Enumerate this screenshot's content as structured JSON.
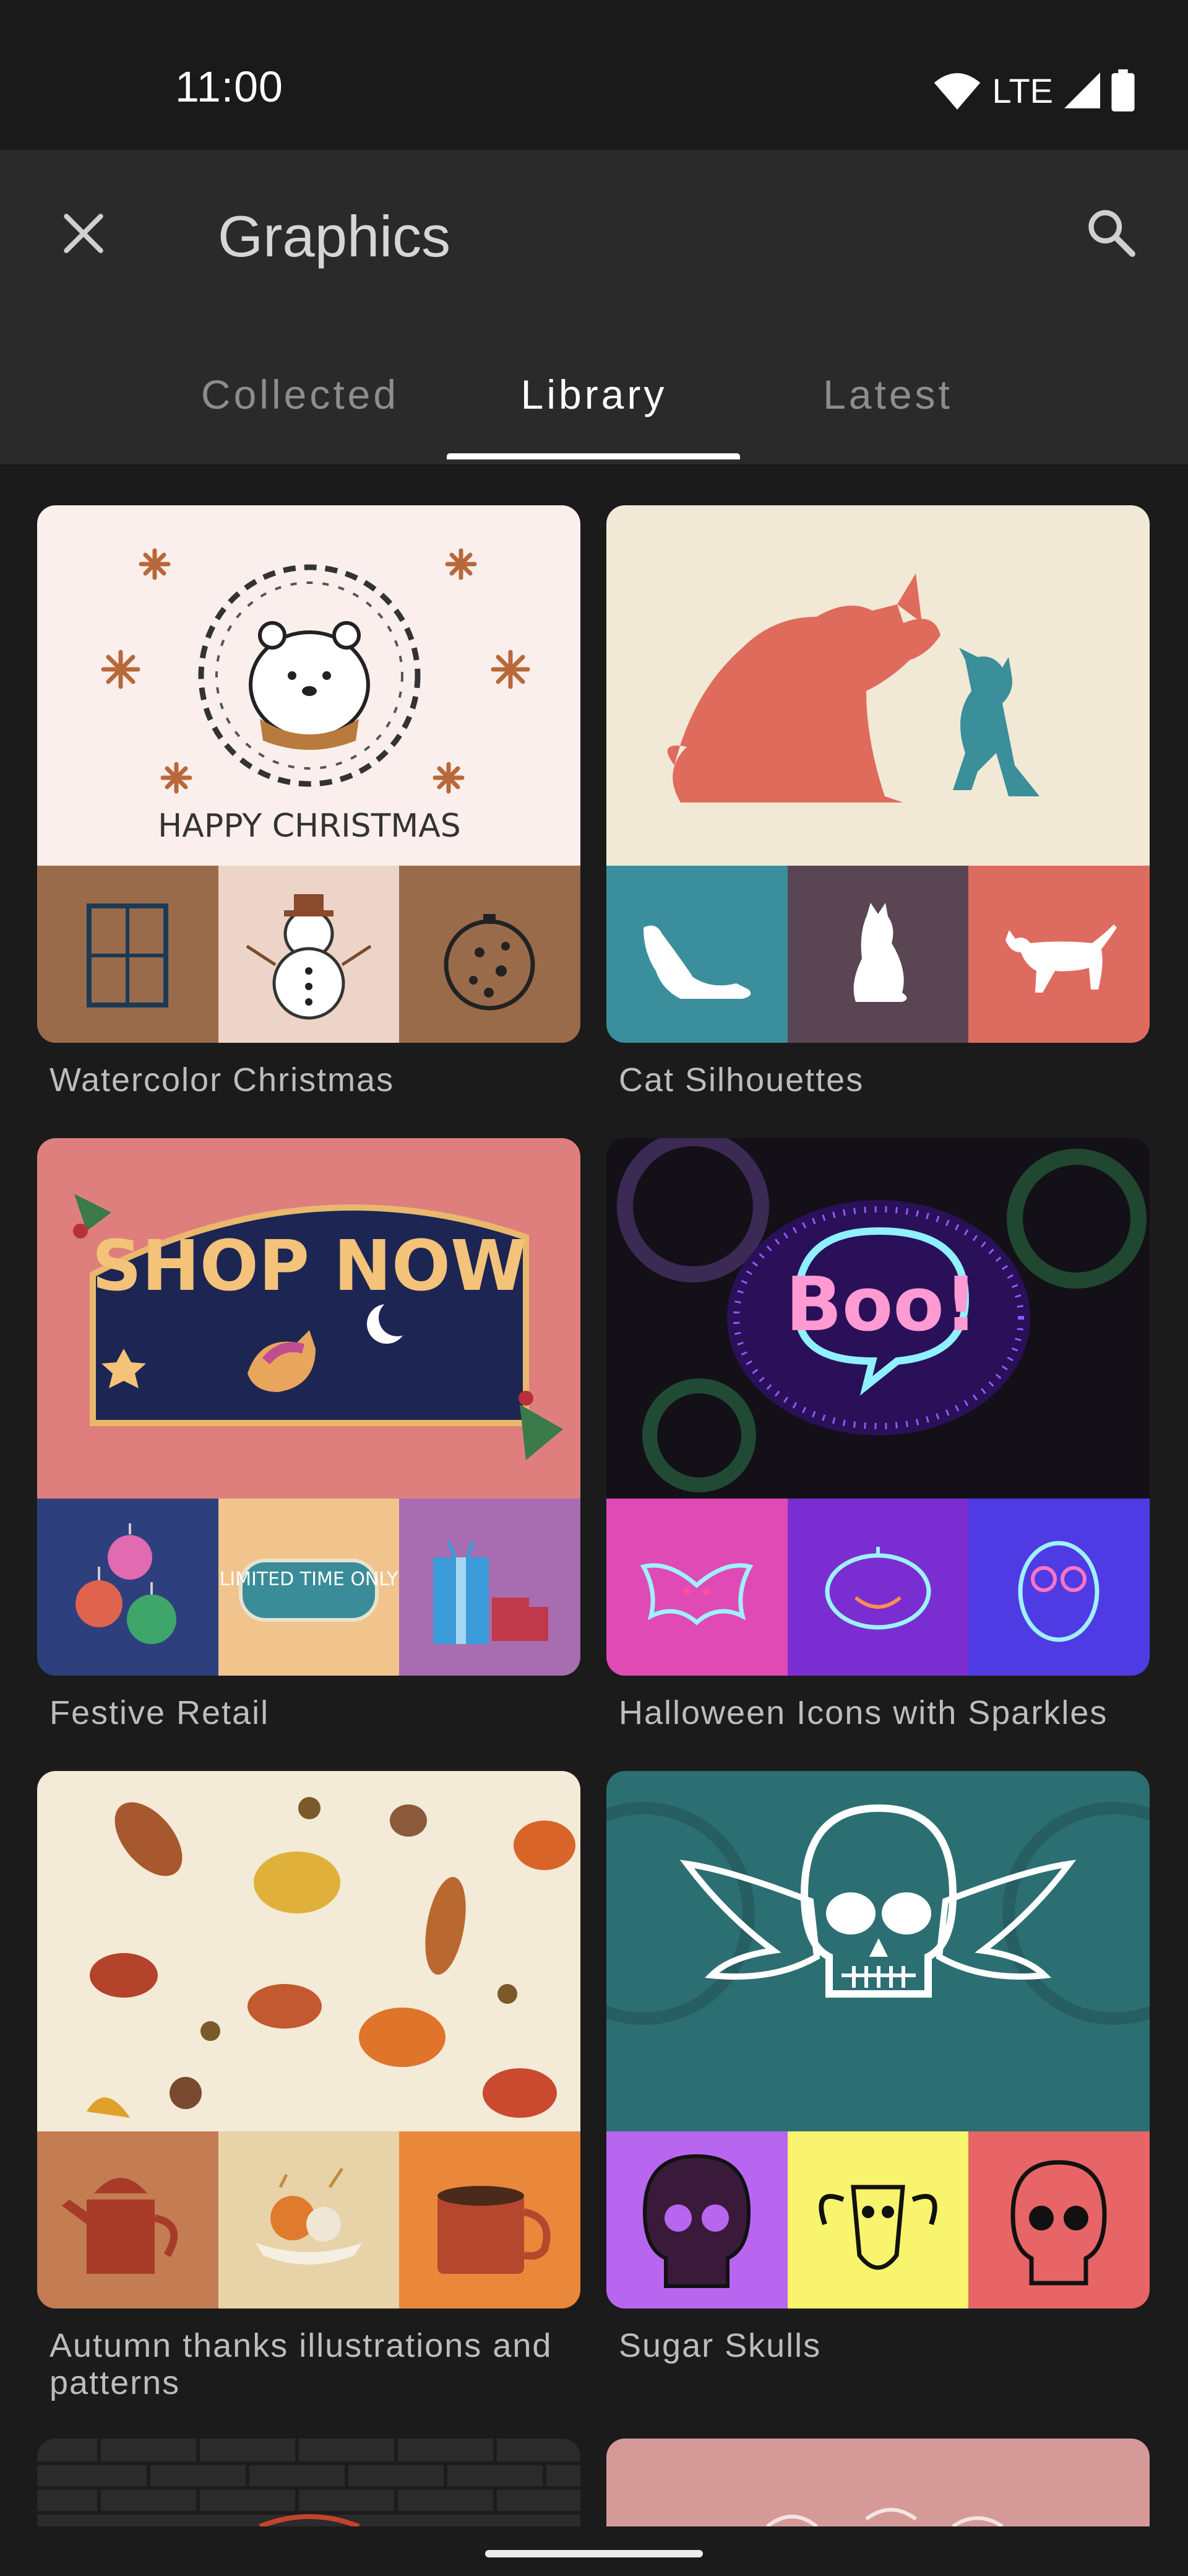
{
  "status_bar": {
    "time": "11:00",
    "network": "LTE",
    "icons": [
      "wifi-icon",
      "cell-signal-icon",
      "battery-icon"
    ]
  },
  "app_bar": {
    "title": "Graphics",
    "close_icon": "close-icon",
    "search_icon": "search-icon"
  },
  "tabs": [
    {
      "label": "Collected",
      "active": false
    },
    {
      "label": "Library",
      "active": true
    },
    {
      "label": "Latest",
      "active": false
    }
  ],
  "collections": [
    {
      "title": "Watercolor Christmas",
      "hero_text": "HAPPY CHRISTMAS"
    },
    {
      "title": "Cat Silhouettes"
    },
    {
      "title": "Festive Retail",
      "hero_text": "SHOP NOW",
      "thumb_text": "LIMITED TIME ONLY"
    },
    {
      "title": "Halloween Icons with Sparkles",
      "hero_text": "Boo!"
    },
    {
      "title": "Autumn thanks illustrations and patterns"
    },
    {
      "title": "Sugar Skulls"
    }
  ],
  "colors": {
    "background": "#1b1b1b",
    "app_bar": "#2a2a2a",
    "tab_active": "#ffffff",
    "tab_inactive": "#8d8d8d",
    "label": "#bdbdbd"
  }
}
